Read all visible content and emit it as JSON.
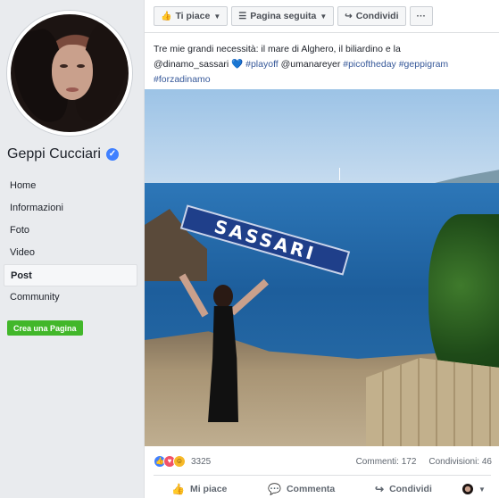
{
  "profile": {
    "name": "Geppi Cucciari",
    "verified": true
  },
  "nav": [
    {
      "label": "Home",
      "active": false
    },
    {
      "label": "Informazioni",
      "active": false
    },
    {
      "label": "Foto",
      "active": false
    },
    {
      "label": "Video",
      "active": false
    },
    {
      "label": "Post",
      "active": true
    },
    {
      "label": "Community",
      "active": false
    }
  ],
  "create_page_label": "Crea una Pagina",
  "top_actions": {
    "like_label": "Ti piace",
    "follow_label": "Pagina seguita",
    "share_label": "Condividi",
    "more_label": "···"
  },
  "post": {
    "text_plain": "Tre mie grandi necessità: il mare di Alghero, il biliardino e la",
    "mention1": "@dinamo_sassari",
    "heart": "💙",
    "tag1": "#playoff",
    "mention2": "@umanareyer",
    "tag2": "#picoftheday",
    "tag3": "#geppigram",
    "tag4": "#forzadinamo",
    "scarf_text": "SASSARI"
  },
  "reactions": {
    "count": "3325",
    "comments": "Commenti: 172",
    "shares": "Condivisioni: 46"
  },
  "bottom_actions": {
    "like": "Mi piace",
    "comment": "Commenta",
    "share": "Condividi"
  },
  "colors": {
    "brand_blue": "#4267b2",
    "link": "#365899",
    "green": "#42b72a"
  }
}
